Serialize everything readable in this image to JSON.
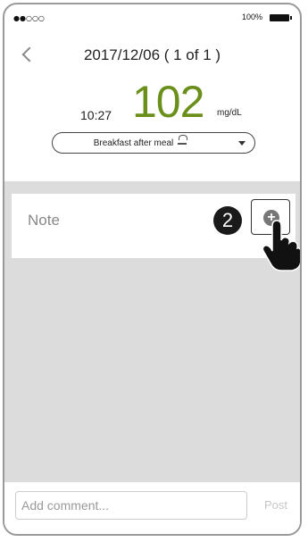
{
  "status_bar": {
    "signal": "●●○○○",
    "battery_percent": "100%"
  },
  "header": {
    "date_label": "2017/12/06 ( 1 of 1 )",
    "time": "10:27",
    "glucose_value": "102",
    "unit": "mg/dL",
    "meal_tag": "Breakfast after meal"
  },
  "note": {
    "label": "Note",
    "step_number": "2"
  },
  "footer": {
    "comment_placeholder": "Add comment...",
    "post_label": "Post"
  },
  "colors": {
    "glucose": "#6b8f1b",
    "background_gray": "#dcdcdc"
  }
}
